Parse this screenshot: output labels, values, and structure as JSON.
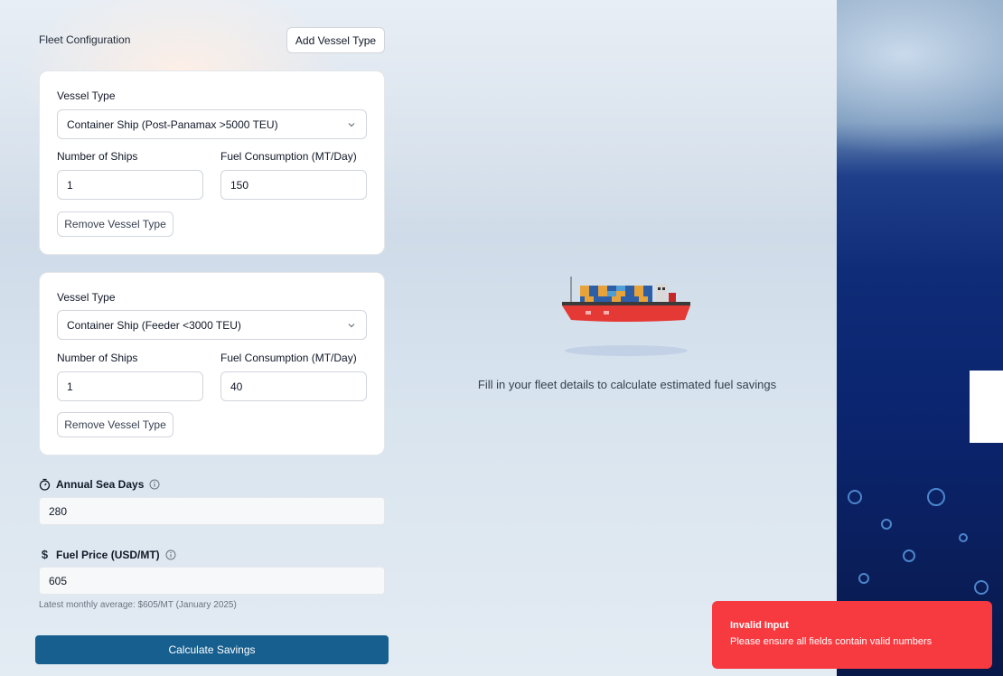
{
  "fleet": {
    "section_title": "Fleet Configuration",
    "add_button": "Add Vessel Type",
    "vessels": [
      {
        "vessel_type_label": "Vessel Type",
        "vessel_type_value": "Container Ship (Post-Panamax >5000 TEU)",
        "ships_label": "Number of Ships",
        "ships_value": "1",
        "fuel_label": "Fuel Consumption (MT/Day)",
        "fuel_value": "150",
        "remove_button": "Remove Vessel Type"
      },
      {
        "vessel_type_label": "Vessel Type",
        "vessel_type_value": "Container Ship (Feeder <3000 TEU)",
        "ships_label": "Number of Ships",
        "ships_value": "1",
        "fuel_label": "Fuel Consumption (MT/Day)",
        "fuel_value": "40",
        "remove_button": "Remove Vessel Type"
      }
    ]
  },
  "sea_days": {
    "icon": "stopwatch-icon",
    "label": "Annual Sea Days",
    "value": "280"
  },
  "fuel_price": {
    "icon": "dollar-icon",
    "label": "Fuel Price (USD/MT)",
    "value": "605",
    "hint": "Latest monthly average: $605/MT (January 2025)"
  },
  "calculate_button": "Calculate Savings",
  "results": {
    "empty_message": "Fill in your fleet details to calculate estimated fuel savings"
  },
  "toast": {
    "title": "Invalid Input",
    "message": "Please ensure all fields contain valid numbers",
    "color": "#f73a40"
  },
  "colors": {
    "primary": "#175f8f",
    "ship_hull": "#e53935"
  }
}
